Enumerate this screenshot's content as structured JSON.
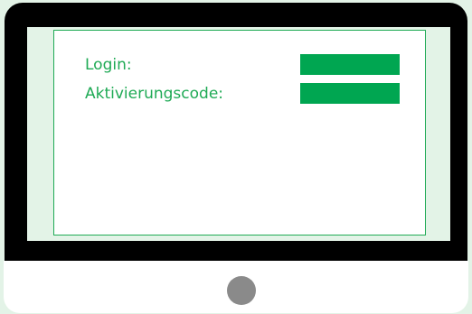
{
  "form": {
    "login_label": "Login:",
    "activation_label": "Aktivierungscode:"
  },
  "colors": {
    "accent": "#1faa55",
    "field_fill": "#00a651",
    "background": "#e3f3e7",
    "bezel": "#000000",
    "button": "#8a8a8a"
  },
  "icons": {
    "home_button": "home-button-icon"
  }
}
